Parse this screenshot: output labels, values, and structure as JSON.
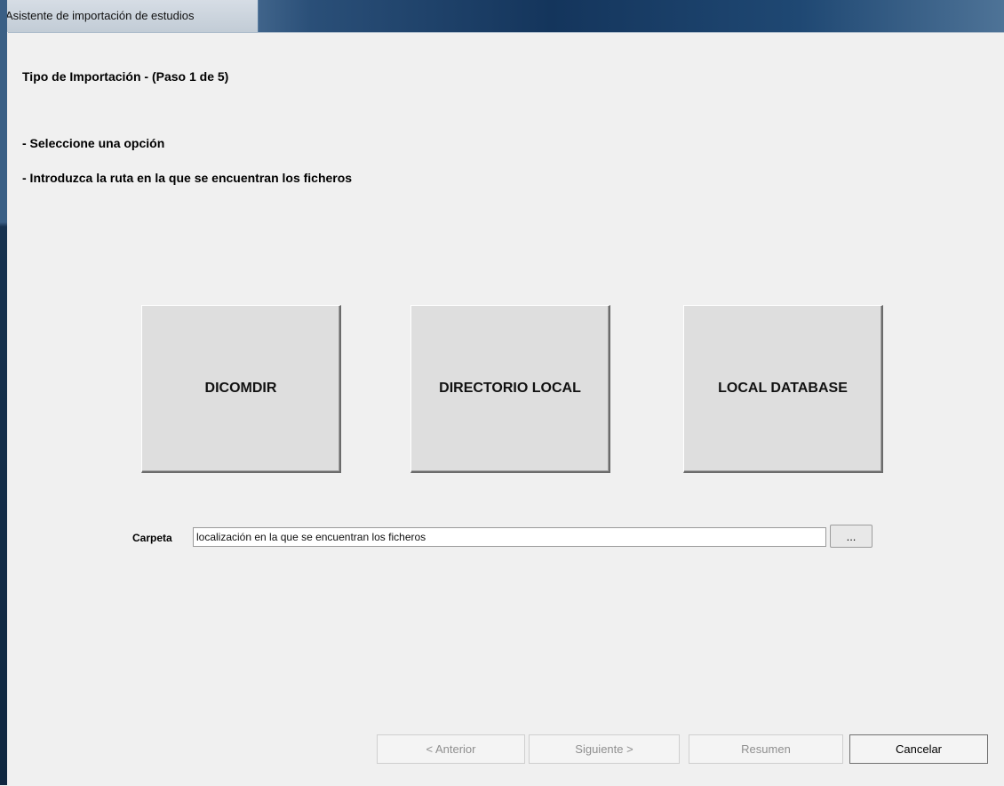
{
  "window": {
    "title": "Asistente de importación de estudios"
  },
  "wizard": {
    "step_title": "Tipo de Importación - (Paso 1 de 5)",
    "instructions": [
      "- Seleccione una opción",
      "- Introduzca la ruta en la que se encuentran los ficheros"
    ]
  },
  "options": [
    {
      "label": "DICOMDIR"
    },
    {
      "label": "DIRECTORIO LOCAL"
    },
    {
      "label": "LOCAL DATABASE"
    }
  ],
  "folder": {
    "label": "Carpeta",
    "value": "localización en la que se encuentran los ficheros",
    "browse_label": "..."
  },
  "navigation": {
    "back_label": "< Anterior",
    "next_label": "Siguiente >",
    "summary_label": "Resumen",
    "cancel_label": "Cancelar",
    "back_enabled": false,
    "next_enabled": false,
    "summary_enabled": false,
    "cancel_enabled": true
  }
}
